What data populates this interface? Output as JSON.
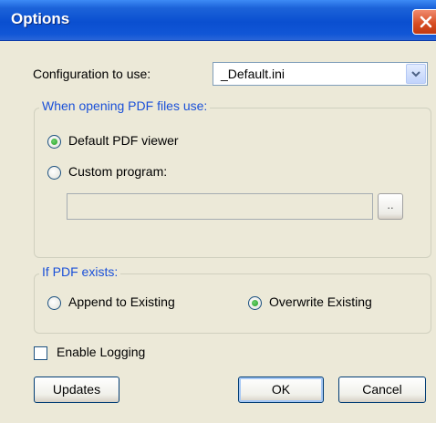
{
  "window": {
    "title": "Options"
  },
  "config": {
    "label": "Configuration to use:",
    "selected": "_Default.ini"
  },
  "pdf_open": {
    "group_title": "When opening PDF files use:",
    "options": [
      {
        "label": "Default PDF viewer",
        "checked": true
      },
      {
        "label": "Custom program:",
        "checked": false
      }
    ],
    "custom_path_value": "",
    "browse_label": ".."
  },
  "pdf_exists": {
    "group_title": "If PDF exists:",
    "options": [
      {
        "label": "Append to Existing",
        "checked": false
      },
      {
        "label": "Overwrite Existing",
        "checked": true
      }
    ]
  },
  "logging": {
    "label": "Enable Logging",
    "checked": false
  },
  "buttons": {
    "updates": "Updates",
    "ok": "OK",
    "cancel": "Cancel"
  },
  "colors": {
    "titlebar": "#0A4FD0",
    "group_title": "#1A50D8",
    "dialog_bg": "#ECE9D8",
    "close": "#D64B21"
  }
}
